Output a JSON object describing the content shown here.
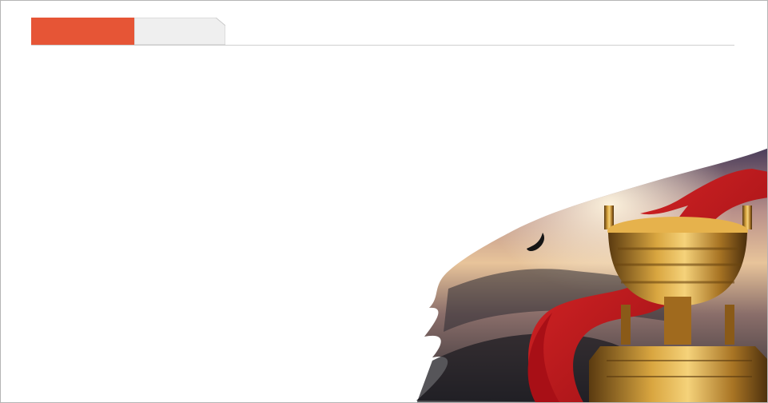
{
  "header": {
    "title": ""
  },
  "colors": {
    "accent": "#e65536",
    "tab_fill": "#efefef",
    "rule": "#cfcfcf",
    "ribbon": "#c8141d",
    "bronze": "#c08a2a"
  },
  "decoration": {
    "icons": [
      "ink-landscape-icon",
      "eagle-icon",
      "ribbon-icon",
      "bronze-ding-icon"
    ]
  }
}
